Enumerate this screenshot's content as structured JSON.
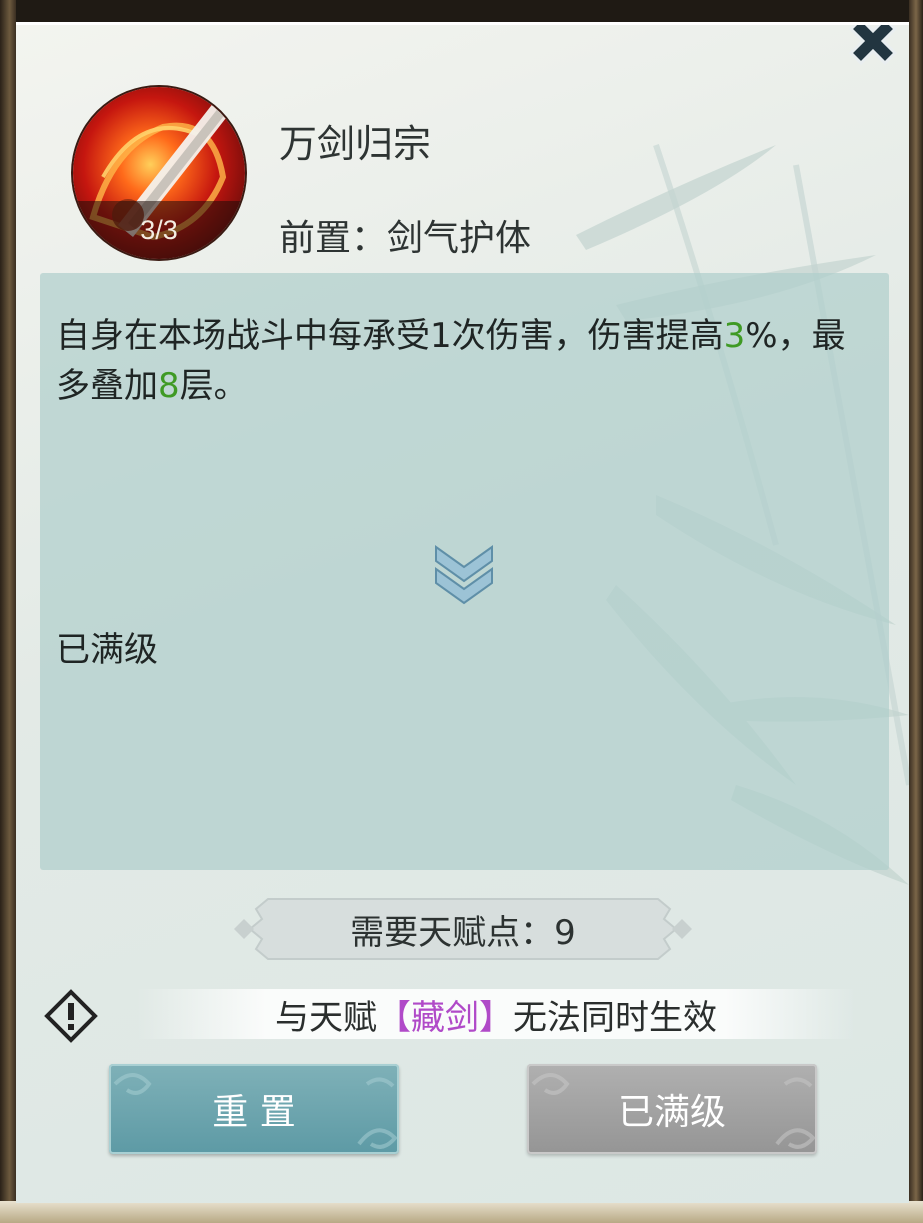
{
  "close": {
    "icon": "close-icon"
  },
  "skill": {
    "name": "万剑归宗",
    "level": "3/3",
    "prerequisite": "前置：剑气护体",
    "icon": "sword-fire-icon"
  },
  "description": {
    "part1": "自身在本场战斗中每承受1次伤害，伤害提高",
    "value1": "3",
    "part2": "%，最多叠加",
    "value2": "8",
    "part3": "层。",
    "highlight_color": "#3f9a24",
    "status": "已满级",
    "expand_icon": "double-chevron-down-icon"
  },
  "cost": {
    "text": "需要天赋点：9"
  },
  "conflict": {
    "prefix": "与天赋",
    "talent": "【藏剑】",
    "suffix": "无法同时生效",
    "talent_color": "#b04ac8",
    "icon": "warning-icon"
  },
  "buttons": {
    "reset_label": "重 置",
    "max_label": "已满级"
  }
}
